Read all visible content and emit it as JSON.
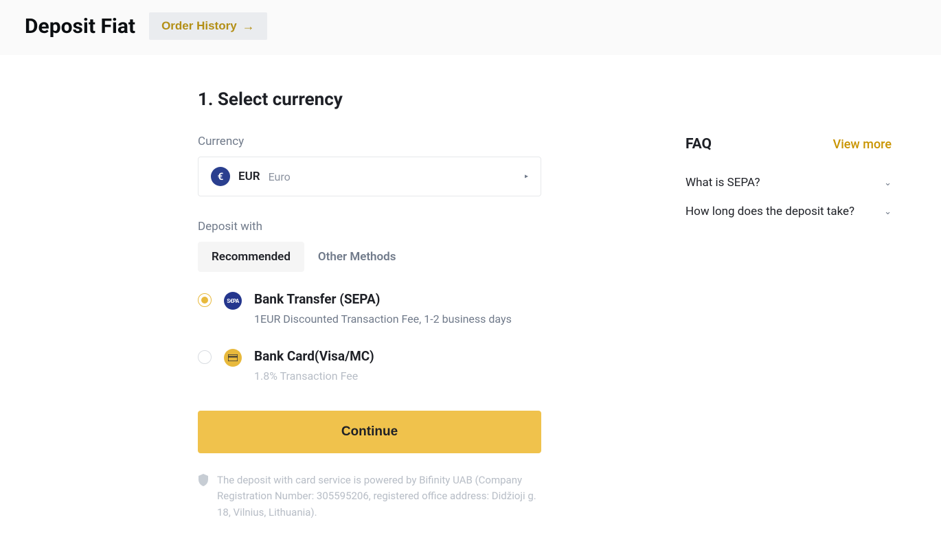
{
  "header": {
    "title": "Deposit Fiat",
    "order_history_label": "Order History"
  },
  "step": {
    "title": "1. Select currency",
    "currency_label": "Currency",
    "currency": {
      "symbol": "€",
      "code": "EUR",
      "name": "Euro"
    },
    "deposit_with_label": "Deposit with",
    "tabs": {
      "recommended": "Recommended",
      "other": "Other Methods"
    },
    "methods": [
      {
        "selected": true,
        "icon_text": "S€PA",
        "title": "Bank Transfer (SEPA)",
        "desc": "1EUR Discounted Transaction Fee, 1-2 business days"
      },
      {
        "selected": false,
        "icon_text": "▭",
        "title": "Bank Card(Visa/MC)",
        "desc": "1.8% Transaction Fee"
      }
    ],
    "continue_label": "Continue",
    "disclaimer": "The deposit with card service is powered by Bifinity UAB (Company Registration Number: 305595206, registered office address: Didžioji g. 18, Vilnius, Lithuania)."
  },
  "faq": {
    "title": "FAQ",
    "view_more": "View more",
    "items": [
      "What is SEPA?",
      "How long does the deposit take?"
    ]
  }
}
